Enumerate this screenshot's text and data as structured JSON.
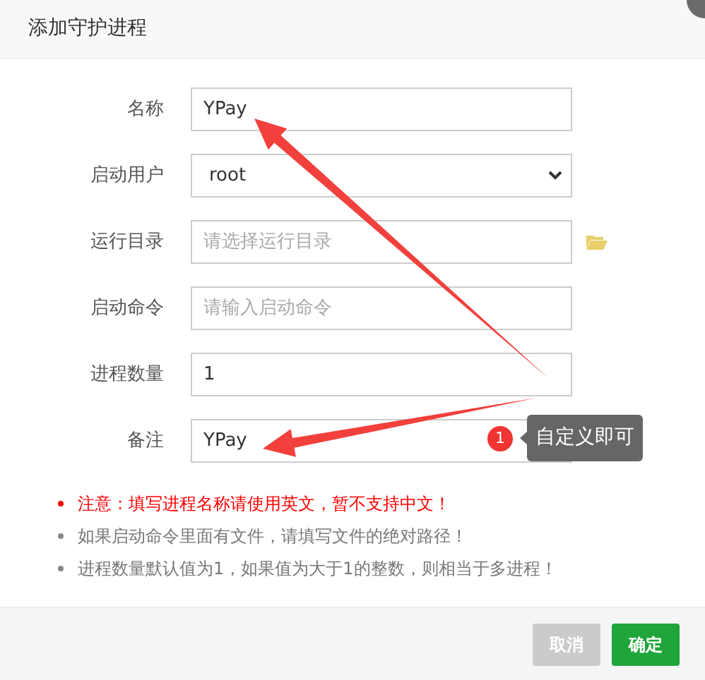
{
  "dialog": {
    "title": "添加守护进程"
  },
  "fields": [
    {
      "label": "名称",
      "kind": "input",
      "value": "YPay"
    },
    {
      "label": "启动用户",
      "kind": "select",
      "value": "root"
    },
    {
      "label": "运行目录",
      "kind": "folder",
      "placeholder": "请选择运行目录"
    },
    {
      "label": "启动命令",
      "kind": "input",
      "placeholder": "请输入启动命令"
    },
    {
      "label": "进程数量",
      "kind": "input",
      "value": "1"
    },
    {
      "label": "备注",
      "kind": "input",
      "value": "YPay"
    }
  ],
  "notes": [
    {
      "kind": "warning",
      "text": "注意：填写进程名称请使用英文，暂不支持中文！"
    },
    {
      "kind": "info",
      "text": "如果启动命令里面有文件，请填写文件的绝对路径！"
    },
    {
      "kind": "info",
      "text": "进程数量默认值为1，如果值为大于1的整数，则相当于多进程！"
    }
  ],
  "buttons": [
    {
      "label": "取消",
      "kind": "secondary"
    },
    {
      "label": "确定",
      "kind": "primary"
    }
  ],
  "annotation": {
    "badge": "1",
    "tooltip": "自定义即可"
  }
}
